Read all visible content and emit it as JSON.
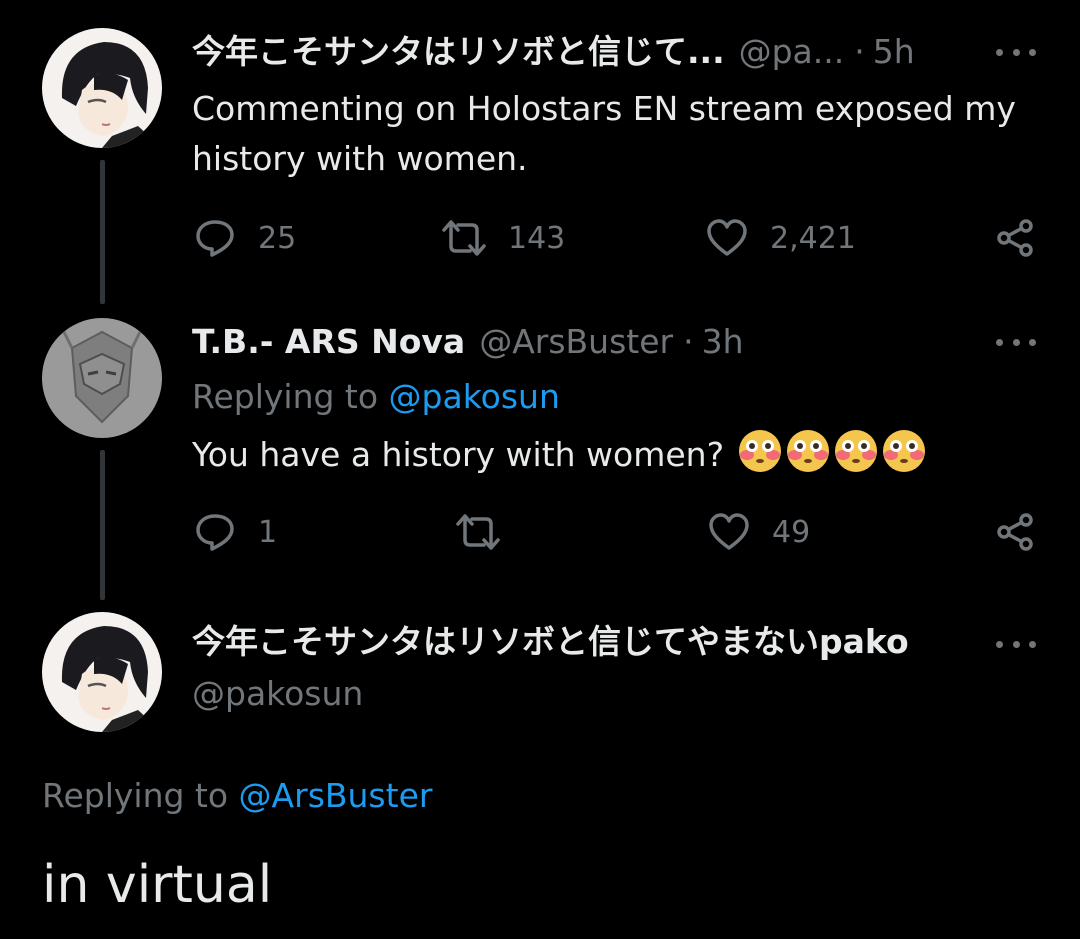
{
  "tweet1": {
    "display_name": "今年こそサンタはリソボと信じて...",
    "handle": "@pa...",
    "time": "5h",
    "text": "Commenting on Holostars EN stream exposed my history with women.",
    "replies": "25",
    "retweets": "143",
    "likes": "2,421"
  },
  "tweet2": {
    "display_name": "T.B.- ARS Nova",
    "handle": "@ArsBuster",
    "time": "3h",
    "replying_prefix": "Replying to",
    "replying_to": "@pakosun",
    "text": "You have a history with women?",
    "emoji": [
      "flushed-face",
      "flushed-face",
      "flushed-face",
      "flushed-face"
    ],
    "replies": "1",
    "retweets": "",
    "likes": "49"
  },
  "tweet3": {
    "display_name": "今年こそサンタはリソボと信じてやまないpako",
    "handle": "@pakosun",
    "replying_prefix": "Replying to",
    "replying_to": "@ArsBuster",
    "text": "in virtual"
  },
  "colors": {
    "background": "#000000",
    "text_primary": "#e7e9ea",
    "text_secondary": "#71767b",
    "accent": "#1d9bf0",
    "thread_line": "#333639"
  }
}
